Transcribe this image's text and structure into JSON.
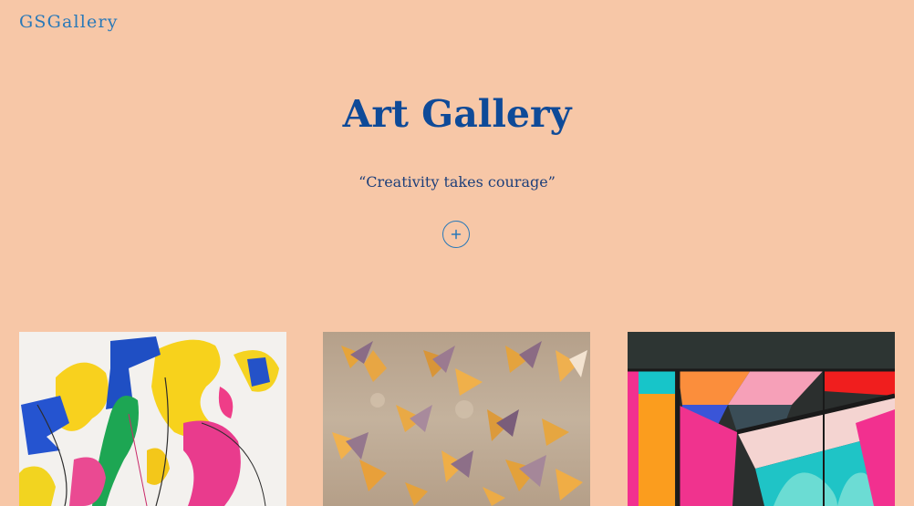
{
  "header": {
    "brand": "GSGallery"
  },
  "hero": {
    "title": "Art Gallery",
    "quote": "“Creativity takes courage”",
    "add_icon": "plus-icon"
  },
  "gallery": {
    "items": [
      {
        "name": "abstract-paint-splash",
        "palette": [
          "#f3f1ee",
          "#f7d21c",
          "#1f4fc4",
          "#e93b8d",
          "#19b24f"
        ]
      },
      {
        "name": "paper-birds-mobile",
        "palette": [
          "#bca791",
          "#e4a23c",
          "#8e6d86",
          "#f1e2cf"
        ]
      },
      {
        "name": "geometric-mural",
        "palette": [
          "#2d3533",
          "#fb9d1e",
          "#f2308f",
          "#3a55d8",
          "#1fc4c6",
          "#f4d4d1"
        ]
      }
    ]
  }
}
